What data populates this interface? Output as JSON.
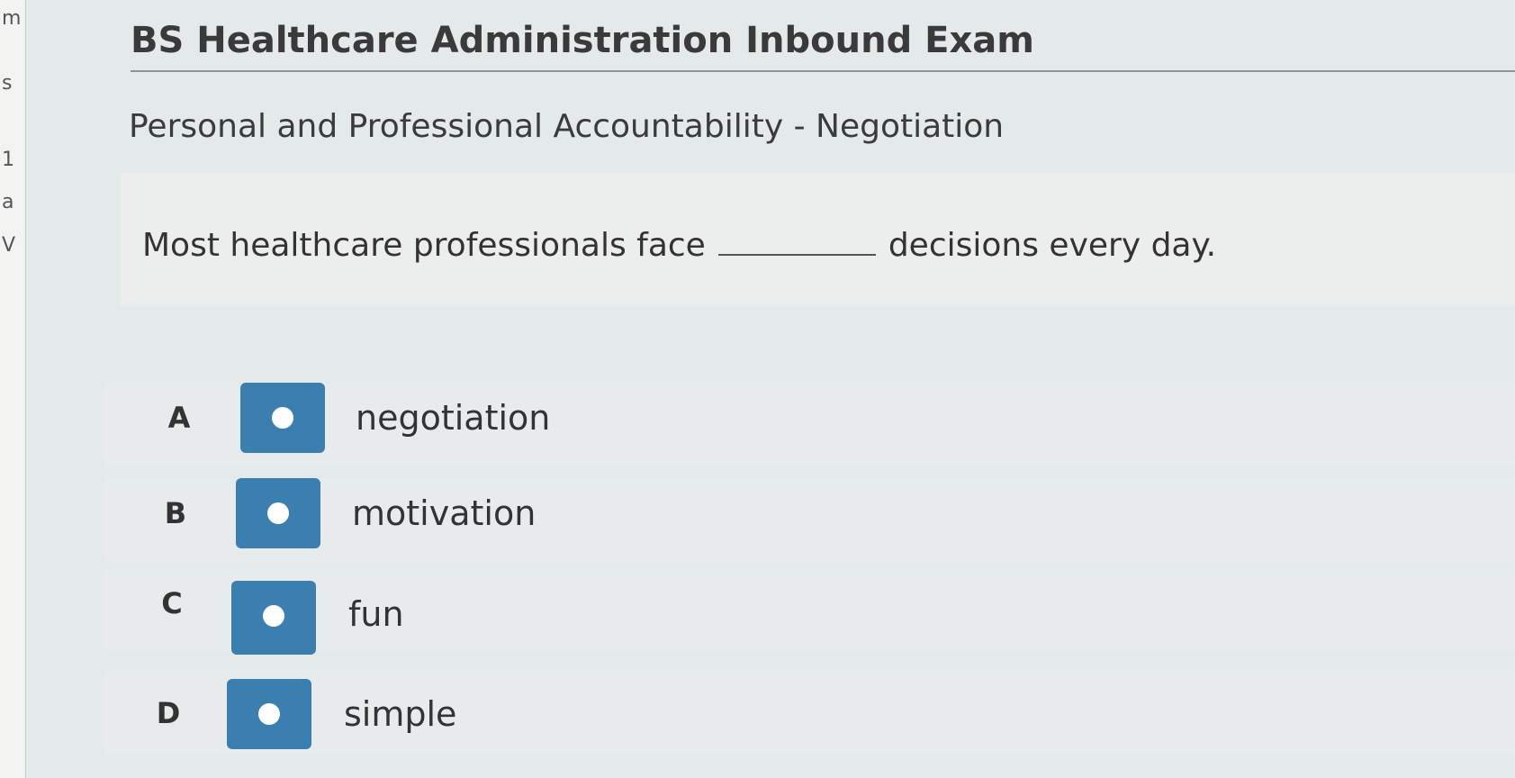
{
  "exam": {
    "title": "BS Healthcare Administration Inbound Exam"
  },
  "section": {
    "title": "Personal and Professional Accountability - Negotiation"
  },
  "question": {
    "text_before_blank": "Most healthcare professionals face",
    "text_after_blank": "decisions every day."
  },
  "options": [
    {
      "letter": "A",
      "label": "negotiation"
    },
    {
      "letter": "B",
      "label": "motivation"
    },
    {
      "letter": "C",
      "label": "fun"
    },
    {
      "letter": "D",
      "label": "simple"
    }
  ],
  "colors": {
    "radio_box": "#3b7fb1",
    "radio_dot": "#ffffff",
    "background": "#e4e9e9"
  },
  "left_edge_fragments": [
    "m",
    "s",
    "1",
    "a",
    "V"
  ]
}
